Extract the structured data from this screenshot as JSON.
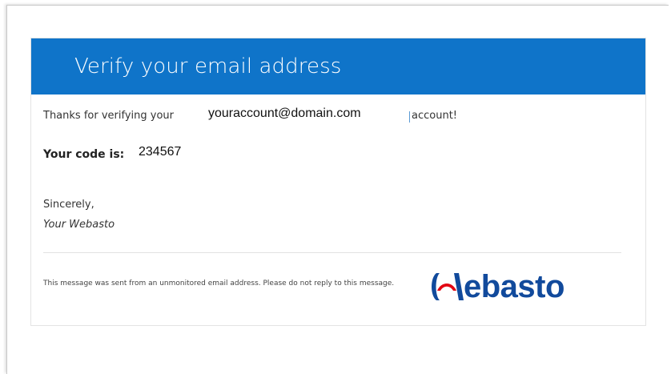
{
  "email": {
    "header_title": "Verify your email address",
    "thanks_prefix": "Thanks for verifying your",
    "account_email": "youraccount@domain.com",
    "thanks_suffix": "account!",
    "code_label": "Your code is:",
    "code_value": "234567",
    "closing": "Sincerely,",
    "signature": "Your Webasto",
    "footer_note": "This message was sent from an unmonitored email address. Please do not reply to this message."
  },
  "logo": {
    "wordmark": "ebasto",
    "brand_color": "#114a9c",
    "accent_color": "#e30613"
  },
  "colors": {
    "banner": "#0f74c9",
    "banner_text": "#ffffff"
  }
}
